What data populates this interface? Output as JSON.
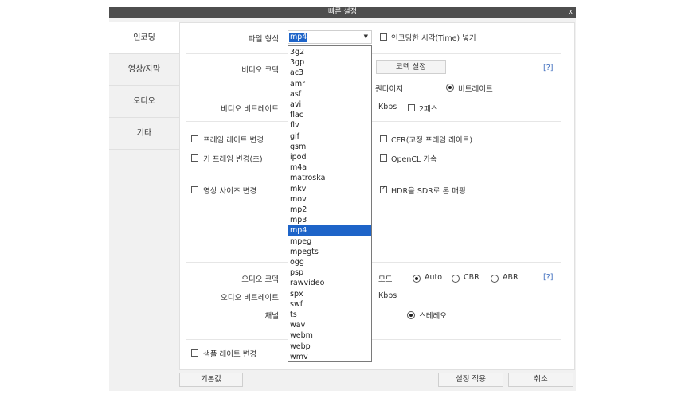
{
  "window": {
    "title": "빠른 설정",
    "close": "x"
  },
  "sidebar": {
    "items": [
      {
        "label": "인코딩"
      },
      {
        "label": "영상/자막"
      },
      {
        "label": "오디오"
      },
      {
        "label": "기타"
      }
    ]
  },
  "format": {
    "label": "파일 형식",
    "value": "mp4",
    "options": [
      "3g2",
      "3gp",
      "ac3",
      "amr",
      "asf",
      "avi",
      "flac",
      "flv",
      "gif",
      "gsm",
      "ipod",
      "m4a",
      "matroska",
      "mkv",
      "mov",
      "mp2",
      "mp3",
      "mp4",
      "mpeg",
      "mpegts",
      "ogg",
      "psp",
      "rawvideo",
      "spx",
      "swf",
      "ts",
      "wav",
      "webm",
      "webp",
      "wmv"
    ]
  },
  "encode_time_label": "인코딩한 시각(Time) 넣기",
  "video": {
    "codec_label": "비디오 코덱",
    "codec_settings": "코덱 설정",
    "help": "[?]",
    "quantizer": "퀀타이저",
    "bitrate_mode": "비트레이트",
    "bitrate_label": "비디오 비트레이트",
    "kbps": "Kbps",
    "two_pass": "2패스"
  },
  "frame_rate_change": "프레임 레이트 변경",
  "cfr": "CFR(고정 프레임 레이트)",
  "keyframe_change": "키 프레임 변경(초)",
  "opencl": "OpenCL 가속",
  "resize": "영상 사이즈 변경",
  "hdr_to_sdr": "HDR을 SDR로 톤 매핑",
  "audio": {
    "codec_label": "오디오 코덱",
    "mode_label": "모드",
    "modes": [
      "Auto",
      "CBR",
      "ABR"
    ],
    "help": "[?]",
    "bitrate_label": "오디오 비트레이트",
    "kbps": "Kbps",
    "channel_label": "채널",
    "stereo": "스테레오"
  },
  "sample_rate_change": "샘플 레이트 변경",
  "buttons": {
    "default": "기본값",
    "apply": "설정 적용",
    "cancel": "취소"
  },
  "colors": {
    "titlebar": "#4e4e4e",
    "selection": "#1e64c8",
    "link": "#3b6bbd"
  }
}
